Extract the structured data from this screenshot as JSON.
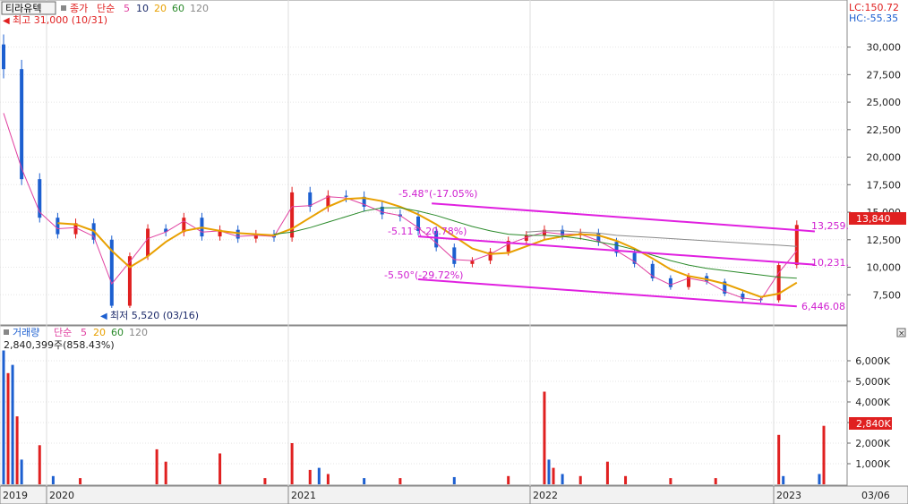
{
  "header": {
    "stock_name": "티라유텍",
    "price_label": "종가",
    "ma_label": "단순",
    "ma_periods": [
      "5",
      "10",
      "20",
      "60",
      "120"
    ],
    "lc": "LC:150.72",
    "hc": "HC:-55.35"
  },
  "volume_header": {
    "label": "거래량",
    "ma_label": "단순",
    "ma_periods": [
      "5",
      "20",
      "60",
      "120"
    ],
    "current": "2,840,399주(858.43%)"
  },
  "annotations": {
    "high": "최고 31,000 (10/31)",
    "low": "최저 5,520 (03/16)",
    "upper_slope": "-5.48°(-17.05%)",
    "mid_slope": "-5.11°(-20.78%)",
    "lower_slope": "-5.50°(-29.72%)",
    "upper_end": "13,259.",
    "mid_end": "10,231.",
    "lower_end": "6,446.08",
    "price_badge": "13,840",
    "volume_badge": "2,840K",
    "date_right": "03/06"
  },
  "colors": {
    "up": "#e02020",
    "down": "#1c5fd0",
    "ma5": "#e040a0",
    "ma10": "#1a2a6a",
    "ma20": "#e8a000",
    "ma60": "#2a8a2a",
    "ma120": "#8a8a8a",
    "trendline": "#e020e0",
    "badge": "#e02020"
  },
  "chart_data": [
    {
      "type": "candlestick",
      "title": "티라유텍",
      "y_ticks": [
        "30,000",
        "27,500",
        "25,000",
        "22,500",
        "20,000",
        "17,500",
        "15,000",
        "12,500",
        "10,000",
        "7,500"
      ],
      "ylim": [
        5000,
        32000
      ],
      "x_labels": [
        "2019",
        "2020",
        "2021",
        "2022",
        "2023"
      ],
      "series": [
        {
          "name": "종가",
          "x": [
            0,
            20,
            40,
            60,
            80,
            100,
            120,
            140,
            160,
            180,
            200,
            220,
            240,
            260,
            280,
            300,
            320,
            340,
            360,
            380,
            400,
            420,
            440,
            460,
            480,
            500,
            520,
            540,
            560,
            580,
            600,
            620,
            640,
            660,
            680,
            700,
            720,
            740,
            760,
            780,
            800,
            820,
            840,
            860,
            880
          ],
          "values": [
            28000,
            18000,
            14500,
            13000,
            14000,
            12500,
            6500,
            11000,
            13500,
            13200,
            14500,
            12800,
            13400,
            12600,
            13000,
            12700,
            16800,
            15500,
            16500,
            16400,
            15500,
            14800,
            14600,
            13300,
            11800,
            10300,
            10600,
            11400,
            12400,
            12900,
            13400,
            12900,
            13100,
            12300,
            11300,
            10300,
            9000,
            8200,
            9200,
            8700,
            7600,
            7100,
            7000,
            10200,
            13840
          ]
        },
        {
          "name": "5",
          "values": [
            24000,
            19000,
            15000,
            13500,
            13600,
            12800,
            8500,
            10500,
            12600,
            13200,
            14200,
            13200,
            13300,
            12800,
            12900,
            12800,
            15500,
            15600,
            16400,
            16300,
            15700,
            15000,
            14700,
            13600,
            12200,
            10700,
            10600,
            11200,
            12100,
            12700,
            13200,
            13000,
            13000,
            12400,
            11500,
            10500,
            9200,
            8400,
            9000,
            8700,
            7800,
            7200,
            7000,
            9500,
            11500
          ]
        },
        {
          "name": "20",
          "values": [
            null,
            null,
            null,
            14000,
            13900,
            13300,
            11500,
            10000,
            11000,
            12300,
            13300,
            13600,
            13300,
            13100,
            13000,
            12900,
            13500,
            14500,
            15500,
            16200,
            16300,
            16000,
            15500,
            14800,
            13900,
            12800,
            11700,
            11200,
            11300,
            11900,
            12500,
            12800,
            13000,
            12900,
            12400,
            11700,
            10800,
            9800,
            9200,
            8900,
            8500,
            7900,
            7300,
            7600,
            8600
          ]
        },
        {
          "name": "60",
          "values": [
            null,
            null,
            null,
            null,
            null,
            null,
            null,
            null,
            null,
            null,
            null,
            null,
            null,
            null,
            null,
            13000,
            13200,
            13600,
            14100,
            14600,
            15100,
            15400,
            15400,
            15100,
            14700,
            14200,
            13700,
            13300,
            13000,
            12900,
            12900,
            12800,
            12600,
            12300,
            12000,
            11600,
            11100,
            10600,
            10200,
            9900,
            9700,
            9500,
            9300,
            9100,
            9000
          ]
        },
        {
          "name": "120",
          "values": [
            null,
            null,
            null,
            null,
            null,
            null,
            null,
            null,
            null,
            null,
            null,
            null,
            null,
            null,
            null,
            null,
            null,
            null,
            null,
            null,
            null,
            null,
            null,
            null,
            null,
            null,
            null,
            null,
            null,
            13200,
            13300,
            13300,
            13200,
            13100,
            12900,
            12800,
            12700,
            12600,
            12500,
            12400,
            12300,
            12200,
            12100,
            12000,
            11900
          ]
        }
      ],
      "trendlines": [
        {
          "from": [
            475,
            15800
          ],
          "to": [
            900,
            13259
          ]
        },
        {
          "from": [
            460,
            12800
          ],
          "to": [
            900,
            10231
          ]
        },
        {
          "from": [
            460,
            8900
          ],
          "to": [
            880,
            6446
          ]
        }
      ]
    },
    {
      "type": "bar",
      "title": "거래량",
      "y_ticks": [
        "6,000K",
        "5,000K",
        "4,000K",
        "3,000K",
        "2,000K",
        "1,000K"
      ],
      "ylim": [
        0,
        7000
      ],
      "x": [
        0,
        5,
        10,
        15,
        20,
        40,
        55,
        85,
        170,
        180,
        240,
        290,
        320,
        340,
        350,
        360,
        400,
        440,
        500,
        560,
        600,
        605,
        610,
        620,
        640,
        670,
        690,
        740,
        790,
        860,
        865,
        905,
        910
      ],
      "values": [
        6500,
        5400,
        5800,
        3300,
        1200,
        1900,
        400,
        300,
        1700,
        1100,
        1500,
        300,
        2000,
        700,
        800,
        500,
        300,
        300,
        350,
        400,
        4500,
        1200,
        800,
        500,
        400,
        1100,
        400,
        300,
        300,
        2400,
        400,
        500,
        2840
      ],
      "colors": [
        "down",
        "up",
        "down",
        "up",
        "down",
        "up",
        "down",
        "up",
        "up",
        "up",
        "up",
        "up",
        "up",
        "up",
        "down",
        "up",
        "down",
        "up",
        "down",
        "up",
        "up",
        "down",
        "up",
        "down",
        "up",
        "up",
        "up",
        "up",
        "up",
        "up",
        "down",
        "down",
        "up"
      ]
    }
  ]
}
